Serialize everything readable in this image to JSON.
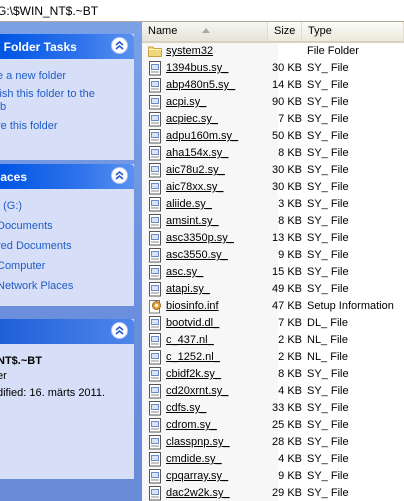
{
  "address": {
    "path": "G:\\$WIN_NT$.~BT"
  },
  "task_pane": {
    "file_folder_tasks": {
      "title": "l Folder Tasks",
      "items": [
        "e a new folder",
        "lish this folder to the\n b",
        "re this folder"
      ]
    },
    "other_places": {
      "title": "laces",
      "items": [
        "t (G:)",
        "Documents",
        "red Documents",
        "Computer",
        "Network Places"
      ]
    },
    "details": {
      "name": "NT$.~BT",
      "type": "er",
      "modified": "dified: 16. märts 2011."
    }
  },
  "columns": {
    "name": "Name",
    "size": "Size",
    "type": "Type"
  },
  "files": [
    {
      "name": "system32",
      "size": "",
      "type": "File Folder",
      "icon": "folder-icon"
    },
    {
      "name": "1394bus.sy_",
      "size": "30 KB",
      "type": "SY_ File",
      "icon": "file-icon"
    },
    {
      "name": "abp480n5.sy_",
      "size": "14 KB",
      "type": "SY_ File",
      "icon": "file-icon"
    },
    {
      "name": "acpi.sy_",
      "size": "90 KB",
      "type": "SY_ File",
      "icon": "file-icon"
    },
    {
      "name": "acpiec.sy_",
      "size": "7 KB",
      "type": "SY_ File",
      "icon": "file-icon"
    },
    {
      "name": "adpu160m.sy_",
      "size": "50 KB",
      "type": "SY_ File",
      "icon": "file-icon"
    },
    {
      "name": "aha154x.sy_",
      "size": "8 KB",
      "type": "SY_ File",
      "icon": "file-icon"
    },
    {
      "name": "aic78u2.sy_",
      "size": "30 KB",
      "type": "SY_ File",
      "icon": "file-icon"
    },
    {
      "name": "aic78xx.sy_",
      "size": "30 KB",
      "type": "SY_ File",
      "icon": "file-icon"
    },
    {
      "name": "aliide.sy_",
      "size": "3 KB",
      "type": "SY_ File",
      "icon": "file-icon"
    },
    {
      "name": "amsint.sy_",
      "size": "8 KB",
      "type": "SY_ File",
      "icon": "file-icon"
    },
    {
      "name": "asc3350p.sy_",
      "size": "13 KB",
      "type": "SY_ File",
      "icon": "file-icon"
    },
    {
      "name": "asc3550.sy_",
      "size": "9 KB",
      "type": "SY_ File",
      "icon": "file-icon"
    },
    {
      "name": "asc.sy_",
      "size": "15 KB",
      "type": "SY_ File",
      "icon": "file-icon"
    },
    {
      "name": "atapi.sy_",
      "size": "49 KB",
      "type": "SY_ File",
      "icon": "file-icon"
    },
    {
      "name": "biosinfo.inf",
      "size": "47 KB",
      "type": "Setup Information",
      "icon": "setup-info-icon"
    },
    {
      "name": "bootvid.dl_",
      "size": "7 KB",
      "type": "DL_ File",
      "icon": "file-icon"
    },
    {
      "name": "c_437.nl_",
      "size": "2 KB",
      "type": "NL_ File",
      "icon": "file-icon"
    },
    {
      "name": "c_1252.nl_",
      "size": "2 KB",
      "type": "NL_ File",
      "icon": "file-icon"
    },
    {
      "name": "cbidf2k.sy_",
      "size": "8 KB",
      "type": "SY_ File",
      "icon": "file-icon"
    },
    {
      "name": "cd20xrnt.sy_",
      "size": "4 KB",
      "type": "SY_ File",
      "icon": "file-icon"
    },
    {
      "name": "cdfs.sy_",
      "size": "33 KB",
      "type": "SY_ File",
      "icon": "file-icon"
    },
    {
      "name": "cdrom.sy_",
      "size": "25 KB",
      "type": "SY_ File",
      "icon": "file-icon"
    },
    {
      "name": "classpnp.sy_",
      "size": "28 KB",
      "type": "SY_ File",
      "icon": "file-icon"
    },
    {
      "name": "cmdide.sy_",
      "size": "4 KB",
      "type": "SY_ File",
      "icon": "file-icon"
    },
    {
      "name": "cpqarray.sy_",
      "size": "9 KB",
      "type": "SY_ File",
      "icon": "file-icon"
    },
    {
      "name": "dac2w2k.sy_",
      "size": "29 KB",
      "type": "SY_ File",
      "icon": "file-icon"
    }
  ]
}
